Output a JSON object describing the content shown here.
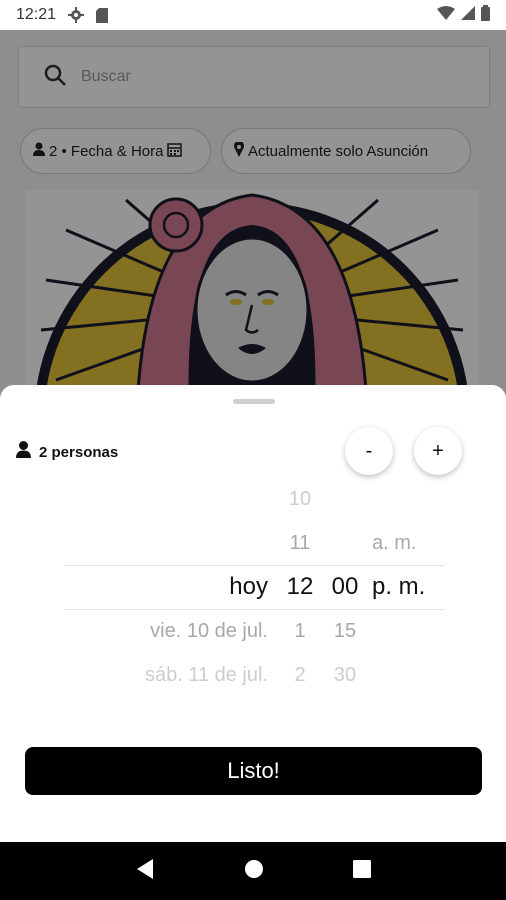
{
  "status_bar": {
    "time": "12:21"
  },
  "app": {
    "search": {
      "placeholder": "Buscar"
    },
    "chips": {
      "date_time": "2 • Fecha & Hora",
      "location": "Actualmente solo Asunción"
    }
  },
  "sheet": {
    "persons_label": "2 personas",
    "minus_label": "-",
    "plus_label": "+",
    "picker": {
      "dates": [
        "hoy",
        "vie. 10 de jul.",
        "sáb. 11 de jul."
      ],
      "hours": [
        "10",
        "11",
        "12",
        "1",
        "2"
      ],
      "minutes": [
        "00",
        "15",
        "30"
      ],
      "periods": [
        "a. m.",
        "p. m."
      ]
    },
    "done_label": "Listo!"
  },
  "colors": {
    "accent": "#000000",
    "sheet_bg": "#ffffff",
    "scrim": "#000000"
  }
}
